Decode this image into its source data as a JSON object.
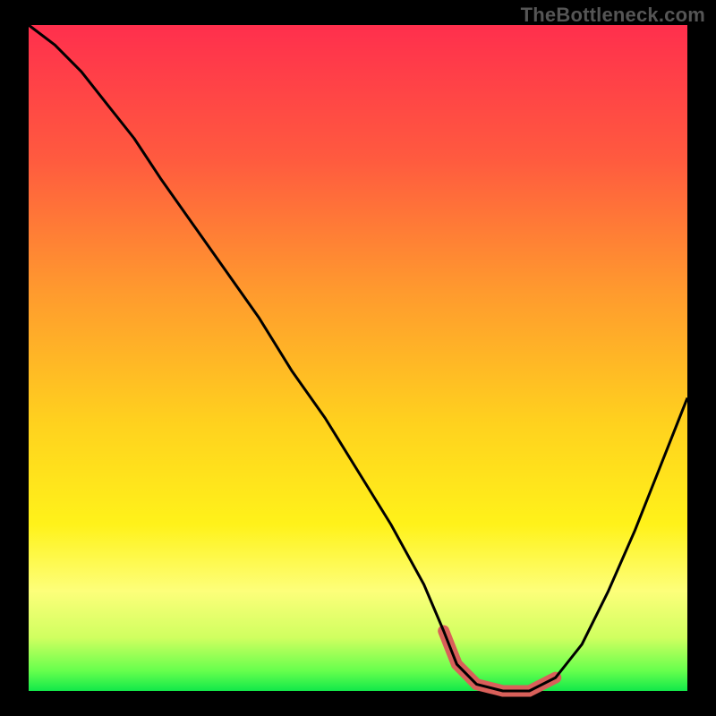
{
  "watermark": "TheBottleneck.com",
  "chart_data": {
    "type": "line",
    "title": "",
    "xlabel": "",
    "ylabel": "",
    "xlim": [
      0,
      100
    ],
    "ylim": [
      0,
      100
    ],
    "grid": false,
    "curve": {
      "name": "bottleneck-curve",
      "x": [
        0,
        4,
        8,
        12,
        16,
        20,
        25,
        30,
        35,
        40,
        45,
        50,
        55,
        60,
        63,
        65,
        68,
        72,
        76,
        80,
        84,
        88,
        92,
        96,
        100
      ],
      "y": [
        100,
        97,
        93,
        88,
        83,
        77,
        70,
        63,
        56,
        48,
        41,
        33,
        25,
        16,
        9,
        4,
        1,
        0,
        0,
        2,
        7,
        15,
        24,
        34,
        44
      ]
    },
    "highlight_band": {
      "x_start": 63,
      "x_end": 80,
      "color": "#d9605a"
    },
    "gradient_stops": [
      {
        "pct": 0,
        "color": "#ff2f4d"
      },
      {
        "pct": 20,
        "color": "#ff5a3f"
      },
      {
        "pct": 40,
        "color": "#ff9a2e"
      },
      {
        "pct": 60,
        "color": "#ffd21e"
      },
      {
        "pct": 75,
        "color": "#fff21a"
      },
      {
        "pct": 85,
        "color": "#fdff7a"
      },
      {
        "pct": 92,
        "color": "#d0ff60"
      },
      {
        "pct": 97,
        "color": "#66ff4d"
      },
      {
        "pct": 100,
        "color": "#12e84a"
      }
    ]
  }
}
